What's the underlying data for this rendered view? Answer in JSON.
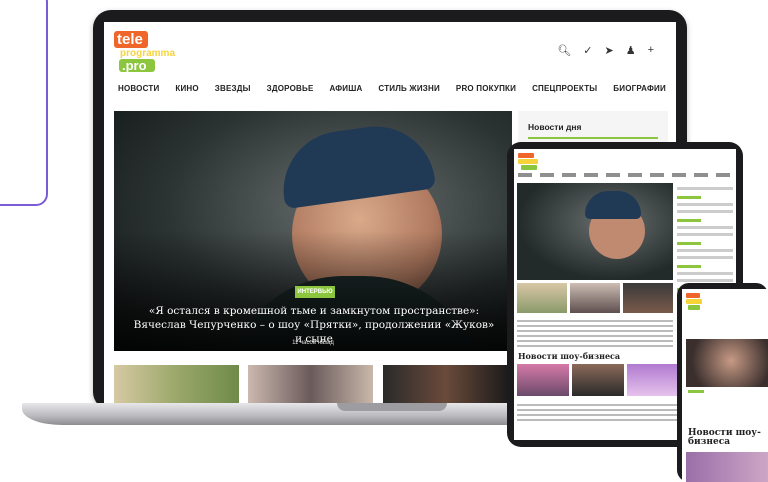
{
  "brand": {
    "logo_line1": "tele",
    "logo_line2": "programma",
    "logo_line3": ".pro",
    "colors": {
      "orange": "#f0662a",
      "green": "#8cc63f",
      "yellow": "#f7d33a"
    }
  },
  "header_icons": [
    "search-icon",
    "vk-icon",
    "telegram-icon",
    "ok-icon",
    "plus-icon"
  ],
  "nav": [
    "НОВОСТИ",
    "КИНО",
    "ЗВЕЗДЫ",
    "ЗДОРОВЬЕ",
    "АФИША",
    "СТИЛЬ ЖИЗНИ",
    "PRO ПОКУПКИ",
    "СПЕЦПРОЕКТЫ",
    "БИОГРАФИИ"
  ],
  "hero": {
    "tag": "ИНТЕРВЬЮ",
    "title": "«Я остался в кромешной тьме и замкнутом пространстве»: Вячеслав Чепурченко – о шоу «Прятки», продолжении «Жуков» и сыне",
    "time": "11 часов назад"
  },
  "sidebar": {
    "title": "Новости дня"
  },
  "tablet": {
    "section_title": "Новости шоу-бизнеса"
  },
  "phone": {
    "section_title": "Новости шоу-бизнеса"
  }
}
